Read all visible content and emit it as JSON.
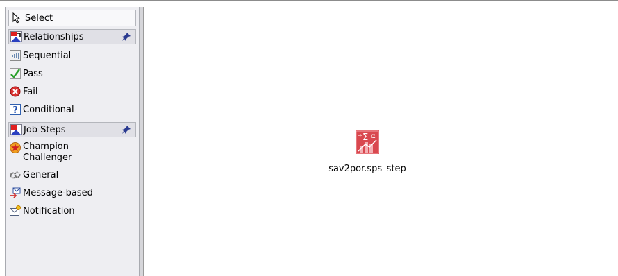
{
  "palette": {
    "select_label": "Select",
    "groups": [
      {
        "header": "Relationships",
        "items": [
          "Sequential",
          "Pass",
          "Fail",
          "Conditional"
        ]
      },
      {
        "header": "Job Steps",
        "items": [
          "Champion Challenger",
          "General",
          "Message-based",
          "Notification"
        ]
      }
    ]
  },
  "canvas": {
    "node_label": "sav2por.sps_step"
  },
  "colors": {
    "palette_bg": "#eeeef2",
    "node_red": "#d9484f"
  }
}
